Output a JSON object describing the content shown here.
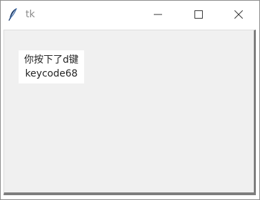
{
  "window": {
    "title": "tk",
    "app_icon": "feather-icon",
    "controls": {
      "minimize_icon": "minimize-icon",
      "maximize_icon": "maximize-icon",
      "close_icon": "close-icon"
    }
  },
  "label": {
    "line1": "你按下了d键",
    "line2": "keycode68"
  }
}
